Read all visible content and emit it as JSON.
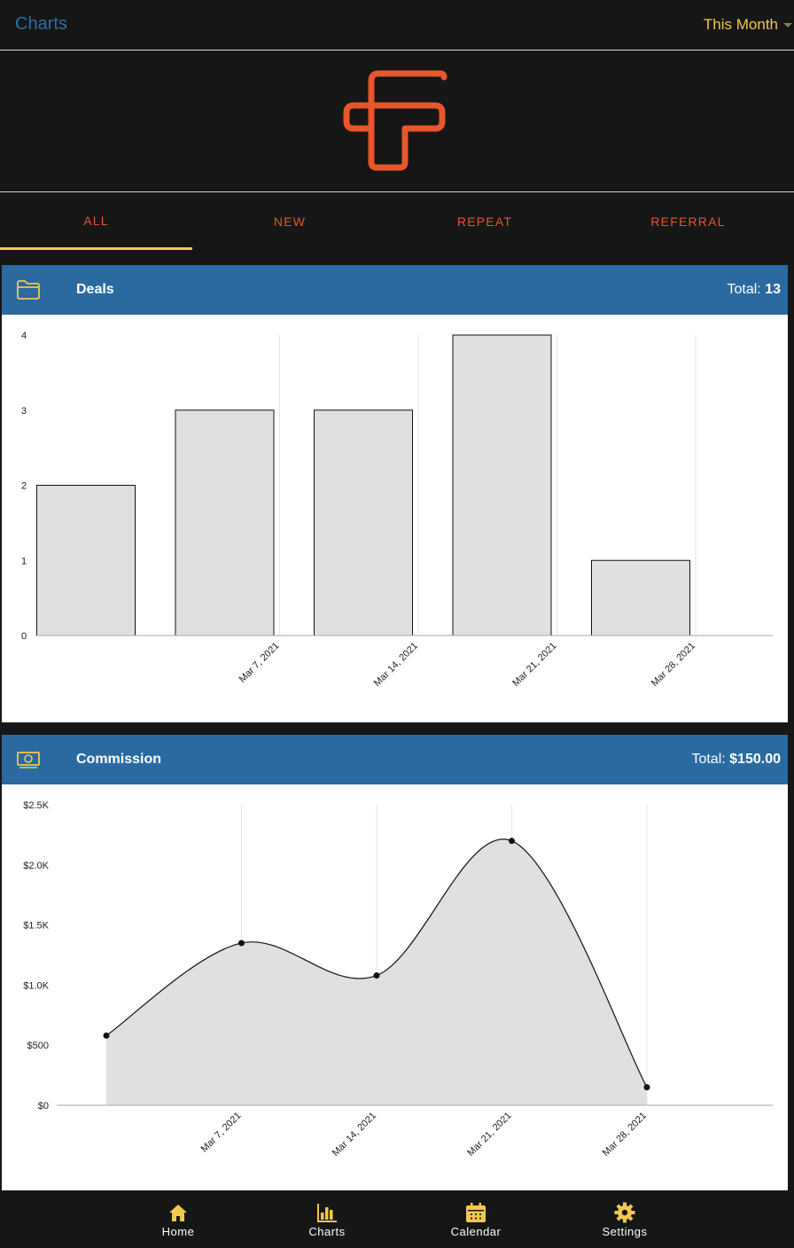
{
  "header": {
    "title": "Charts",
    "period": "This Month"
  },
  "tabs": [
    {
      "label": "ALL",
      "active": true
    },
    {
      "label": "NEW",
      "active": false
    },
    {
      "label": "REPEAT",
      "active": false
    },
    {
      "label": "REFERRAL",
      "active": false
    }
  ],
  "deals": {
    "title": "Deals",
    "total_label": "Total:",
    "total_value": "13",
    "icon": "folder-icon"
  },
  "commission": {
    "title": "Commission",
    "total_label": "Total:",
    "total_value": "$150.00",
    "icon": "money-icon"
  },
  "colors": {
    "accent": "#f2c94c",
    "brand": "#e8562b",
    "header_blue": "#2a6aa0",
    "fill": "#e0e0e0"
  },
  "nav": [
    {
      "label": "Home",
      "icon": "home-icon"
    },
    {
      "label": "Charts",
      "icon": "bar-chart-icon"
    },
    {
      "label": "Calendar",
      "icon": "calendar-icon"
    },
    {
      "label": "Settings",
      "icon": "gear-icon"
    }
  ],
  "chart_data": [
    {
      "type": "bar",
      "categories": [
        "",
        "Mar 7, 2021",
        "Mar 14, 2021",
        "Mar 21, 2021",
        "Mar 28, 2021"
      ],
      "values": [
        2,
        3,
        3,
        4,
        1
      ],
      "yticks": [
        "0",
        "1",
        "2",
        "3",
        "4"
      ],
      "ylim": [
        0,
        4
      ],
      "grid": "vertical"
    },
    {
      "type": "area",
      "categories": [
        "",
        "Mar 7, 2021",
        "Mar 14, 2021",
        "Mar 21, 2021",
        "Mar 28, 2021"
      ],
      "values": [
        580,
        1350,
        1080,
        2200,
        150
      ],
      "yticks": [
        "$0",
        "$500",
        "$1.0K",
        "$1.5K",
        "$2.0K",
        "$2.5K"
      ],
      "ylim": [
        0,
        2500
      ],
      "grid": "vertical"
    }
  ]
}
